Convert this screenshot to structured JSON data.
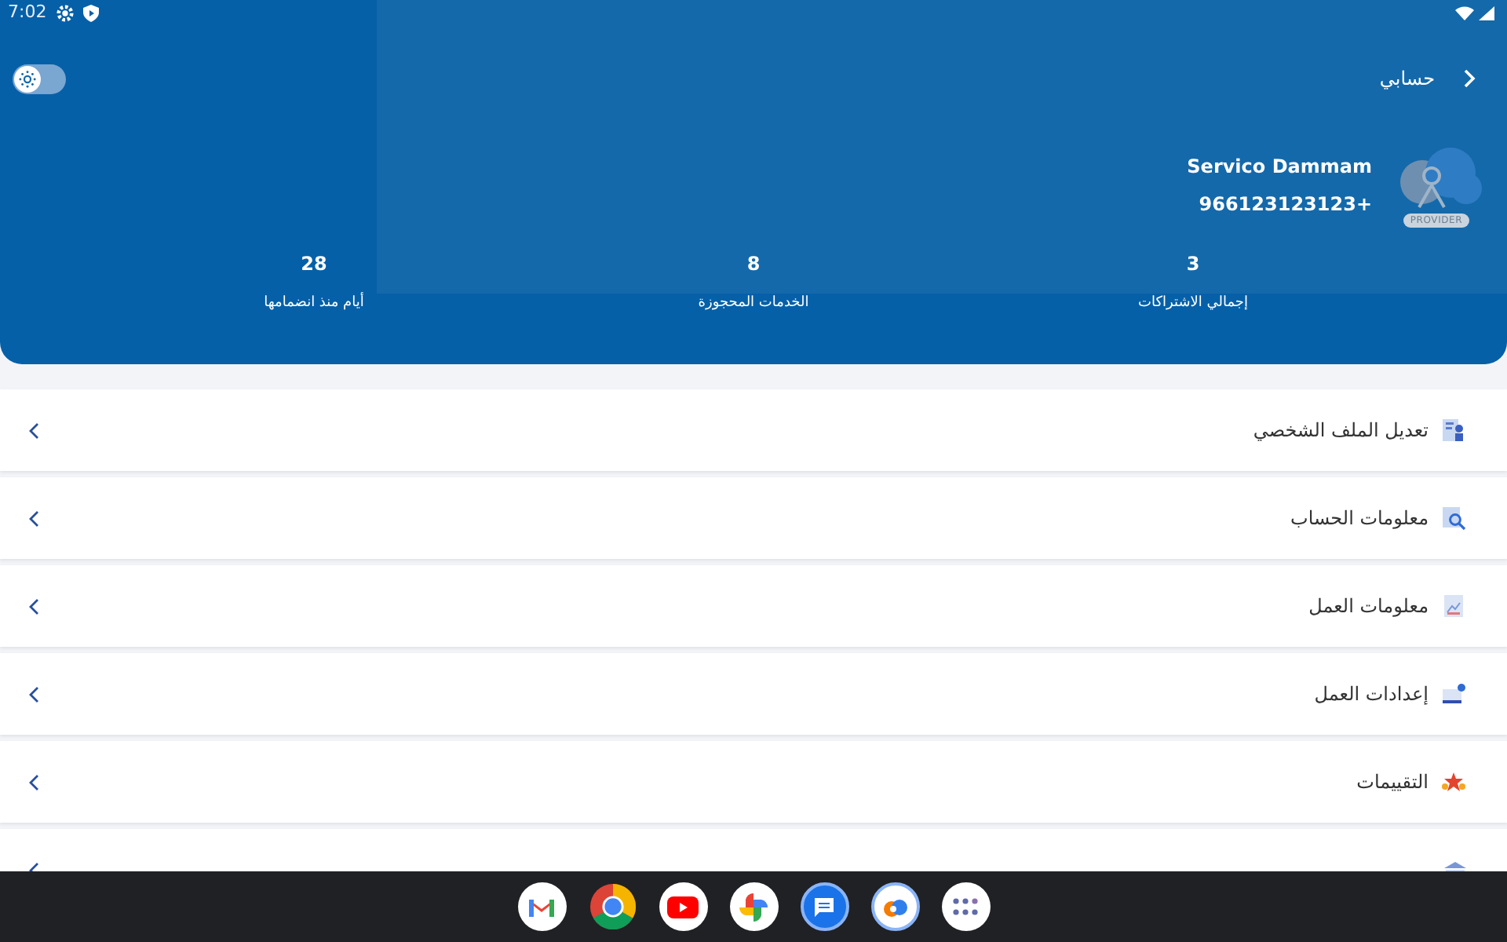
{
  "status_bar": {
    "time": "7:02"
  },
  "header": {
    "title": "حسابي",
    "theme_toggle": {
      "on": false
    }
  },
  "profile": {
    "name": "Servico Dammam",
    "phone": "966123123123+",
    "avatar_badge": "PROVIDER"
  },
  "stats": [
    {
      "value": "3",
      "label": "إجمالي الاشتراكات"
    },
    {
      "value": "8",
      "label": "الخدمات المحجوزة"
    },
    {
      "value": "28",
      "label": "أيام منذ انضمامها"
    }
  ],
  "menu": [
    {
      "kind": "profile",
      "label": "تعديل الملف الشخصي"
    },
    {
      "kind": "account",
      "label": "معلومات الحساب"
    },
    {
      "kind": "work",
      "label": "معلومات العمل"
    },
    {
      "kind": "settings",
      "label": "إعدادات العمل"
    },
    {
      "kind": "ratings",
      "label": "التقييمات"
    },
    {
      "kind": "bank"
    }
  ],
  "dock": [
    {
      "kind": "mail"
    },
    {
      "kind": "browser"
    },
    {
      "kind": "video"
    },
    {
      "kind": "photos"
    },
    {
      "kind": "messages"
    },
    {
      "kind": "cloud"
    },
    {
      "kind": "apps"
    }
  ]
}
